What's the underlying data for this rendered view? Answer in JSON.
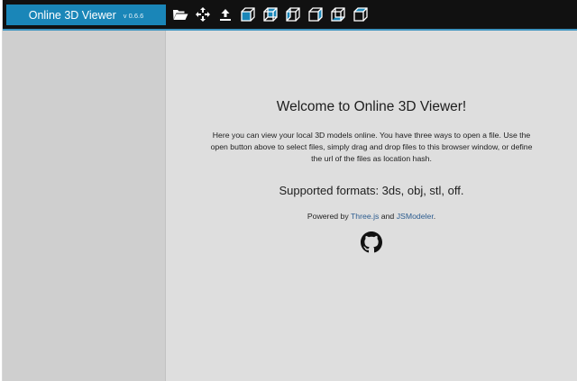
{
  "header": {
    "app_name": "Online 3D Viewer",
    "version": "v 0.6.6"
  },
  "toolbar": {
    "items": [
      {
        "name": "open-icon",
        "label": "Open"
      },
      {
        "name": "fit-to-window-icon",
        "label": "Fit"
      },
      {
        "name": "set-up-vector-icon",
        "label": "Up"
      },
      {
        "name": "front-view-icon",
        "label": "Front"
      },
      {
        "name": "back-view-icon",
        "label": "Back"
      },
      {
        "name": "left-view-icon",
        "label": "Left"
      },
      {
        "name": "right-view-icon",
        "label": "Right"
      },
      {
        "name": "bottom-view-icon",
        "label": "Bottom"
      },
      {
        "name": "top-view-icon",
        "label": "Top"
      }
    ]
  },
  "welcome": {
    "title": "Welcome to Online 3D Viewer!",
    "description": "Here you can view your local 3D models online. You have three ways to open a file. Use the open button above to select files, simply drag and drop files to this browser window, or define the url of the files as location hash.",
    "formats": "Supported formats: 3ds, obj, stl, off.",
    "powered_prefix": "Powered by ",
    "lib1": "Three.js",
    "powered_and": " and ",
    "lib2": "JSModeler",
    "powered_suffix": "."
  },
  "colors": {
    "accent": "#1a86b8",
    "topbar": "#111111",
    "sidebar": "#cfcfcf",
    "main": "#dedede",
    "link": "#2c5c8f"
  }
}
